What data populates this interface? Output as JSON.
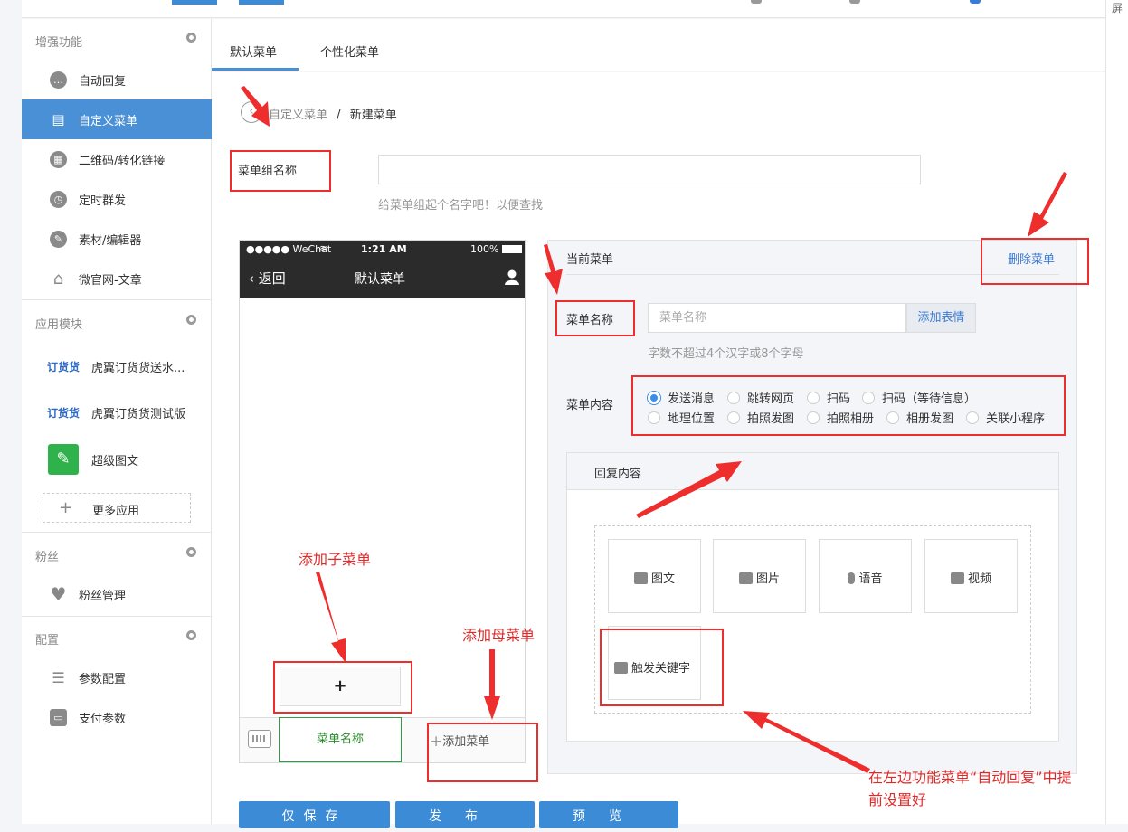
{
  "right_strip": {
    "label": "屏"
  },
  "sidebar": {
    "sections": [
      {
        "title": "增强功能"
      },
      {
        "title": "应用模块"
      },
      {
        "title": "粉丝"
      },
      {
        "title": "配置"
      }
    ],
    "enhance_items": [
      {
        "label": "自动回复",
        "icon": "chat-bubble-icon"
      },
      {
        "label": "自定义菜单",
        "icon": "document-edit-icon"
      },
      {
        "label": "二维码/转化链接",
        "icon": "qrcode-icon"
      },
      {
        "label": "定时群发",
        "icon": "clock-icon"
      },
      {
        "label": "素材/编辑器",
        "icon": "pencil-icon"
      },
      {
        "label": "微官网-文章",
        "icon": "home-icon"
      }
    ],
    "apps": [
      {
        "logo": "订货货",
        "label": "虎翼订货货送水..."
      },
      {
        "logo": "订货货",
        "label": "虎翼订货货测试版"
      },
      {
        "label": "超级图文"
      }
    ],
    "more_apps": "更多应用",
    "fans_items": [
      {
        "label": "粉丝管理"
      }
    ],
    "config_items": [
      {
        "label": "参数配置"
      },
      {
        "label": "支付参数"
      }
    ]
  },
  "tabs": [
    {
      "label": "默认菜单"
    },
    {
      "label": "个性化菜单"
    }
  ],
  "breadcrumb": {
    "parent": "自定义菜单",
    "sep": "/",
    "current": "新建菜单"
  },
  "group": {
    "label": "菜单组名称",
    "value": "",
    "hint": "给菜单组起个名字吧！以便查找"
  },
  "phone": {
    "carrier": "●●●●● WeChat",
    "time": "1:21 AM",
    "battery": "100%",
    "back": "返回",
    "title": "默认菜单",
    "add_sub": "+",
    "menu_item": "菜单名称",
    "add_menu": "添加菜单"
  },
  "panel": {
    "title": "当前菜单",
    "delete": "删除菜单",
    "name_label": "菜单名称",
    "name_placeholder": "菜单名称",
    "add_emoji": "添加表情",
    "name_hint": "字数不超过4个汉字或8个字母",
    "content_label": "菜单内容",
    "options_row1": [
      "发送消息",
      "跳转网页",
      "扫码",
      "扫码（等待信息）"
    ],
    "options_row2": [
      "地理位置",
      "拍照发图",
      "拍照相册",
      "相册发图",
      "关联小程序"
    ],
    "selected": "发送消息",
    "reply_title": "回复内容",
    "reply_types": [
      "图文",
      "图片",
      "语音",
      "视频"
    ],
    "keyword": "触发关键字"
  },
  "bottom_buttons": [
    "仅保存",
    "发布",
    "预览"
  ],
  "annotations": {
    "add_sub": "添加子菜单",
    "add_parent": "添加母菜单",
    "note_line1": "在左边功能菜单“自动回复”中提",
    "note_line2": "前设置好"
  },
  "colors": {
    "accent": "#4a90d6",
    "annotation": "#ee2d2d",
    "menu_green": "#2ea043"
  }
}
